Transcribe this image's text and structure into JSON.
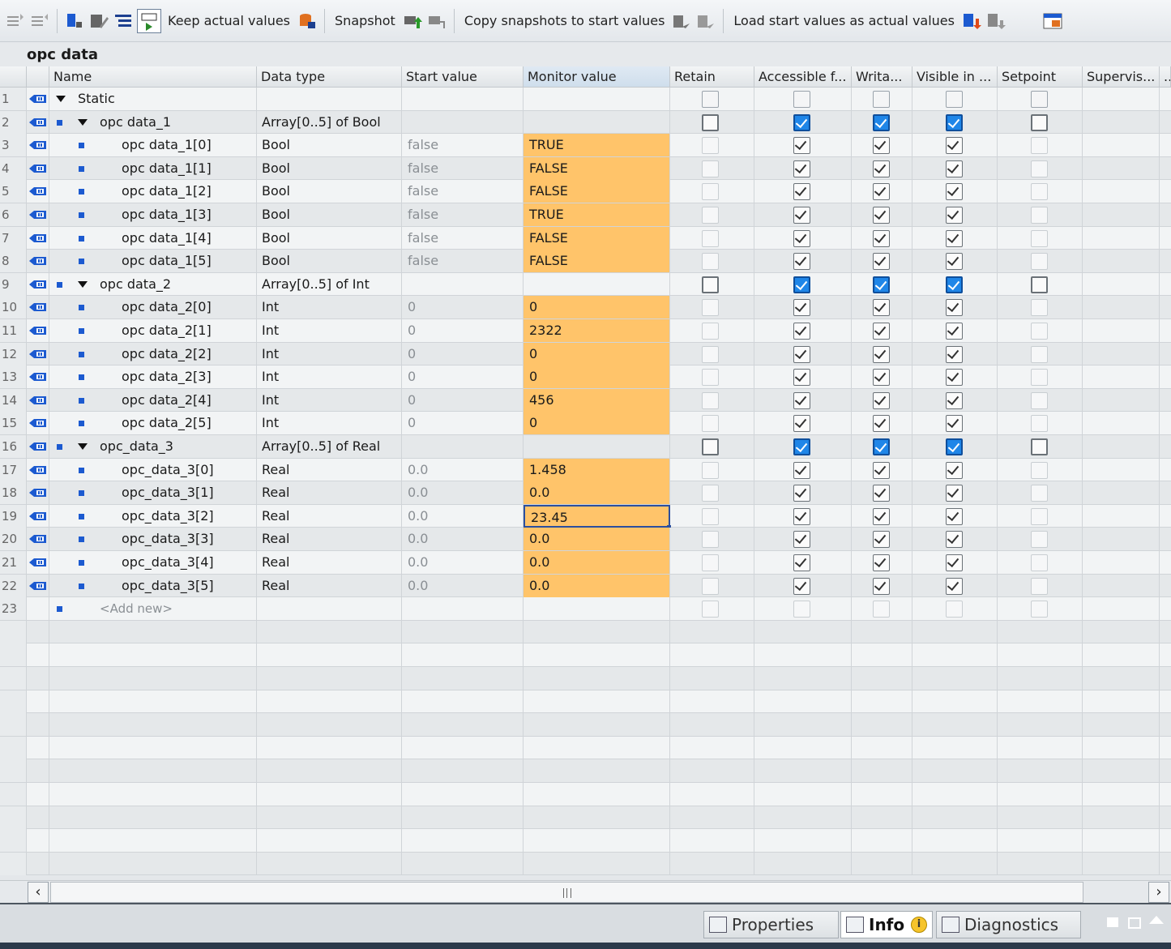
{
  "toolbar": {
    "keep_actual_label": "Keep actual values",
    "snapshot_label": "Snapshot",
    "copy_snapshots_label": "Copy snapshots to start values",
    "load_start_label": "Load start values as actual values"
  },
  "block_title": "opc data",
  "columns": {
    "name": "Name",
    "data_type": "Data type",
    "start_value": "Start value",
    "monitor_value": "Monitor value",
    "retain": "Retain",
    "accessible": "Accessible f...",
    "writable": "Writa...",
    "visible": "Visible in ...",
    "setpoint": "Setpoint",
    "supervision": "Supervis...",
    "more": ".."
  },
  "rows": [
    {
      "num": "1",
      "name": "Static",
      "type": "",
      "start": "",
      "monitor": "",
      "kind": "section"
    },
    {
      "num": "2",
      "name": "opc data_1",
      "type": "Array[0..5] of Bool",
      "start": "",
      "monitor": "",
      "kind": "array"
    },
    {
      "num": "3",
      "name": "opc data_1[0]",
      "type": "Bool",
      "start": "false",
      "monitor": "TRUE",
      "kind": "elem"
    },
    {
      "num": "4",
      "name": "opc data_1[1]",
      "type": "Bool",
      "start": "false",
      "monitor": "FALSE",
      "kind": "elem"
    },
    {
      "num": "5",
      "name": "opc data_1[2]",
      "type": "Bool",
      "start": "false",
      "monitor": "FALSE",
      "kind": "elem"
    },
    {
      "num": "6",
      "name": "opc data_1[3]",
      "type": "Bool",
      "start": "false",
      "monitor": "TRUE",
      "kind": "elem"
    },
    {
      "num": "7",
      "name": "opc data_1[4]",
      "type": "Bool",
      "start": "false",
      "monitor": "FALSE",
      "kind": "elem"
    },
    {
      "num": "8",
      "name": "opc data_1[5]",
      "type": "Bool",
      "start": "false",
      "monitor": "FALSE",
      "kind": "elem"
    },
    {
      "num": "9",
      "name": "opc data_2",
      "type": "Array[0..5] of Int",
      "start": "",
      "monitor": "",
      "kind": "array"
    },
    {
      "num": "10",
      "name": "opc data_2[0]",
      "type": "Int",
      "start": "0",
      "monitor": "0",
      "kind": "elem"
    },
    {
      "num": "11",
      "name": "opc data_2[1]",
      "type": "Int",
      "start": "0",
      "monitor": "2322",
      "kind": "elem"
    },
    {
      "num": "12",
      "name": "opc data_2[2]",
      "type": "Int",
      "start": "0",
      "monitor": "0",
      "kind": "elem"
    },
    {
      "num": "13",
      "name": "opc data_2[3]",
      "type": "Int",
      "start": "0",
      "monitor": "0",
      "kind": "elem"
    },
    {
      "num": "14",
      "name": "opc data_2[4]",
      "type": "Int",
      "start": "0",
      "monitor": "456",
      "kind": "elem"
    },
    {
      "num": "15",
      "name": "opc data_2[5]",
      "type": "Int",
      "start": "0",
      "monitor": "0",
      "kind": "elem"
    },
    {
      "num": "16",
      "name": "opc_data_3",
      "type": "Array[0..5] of Real",
      "start": "",
      "monitor": "",
      "kind": "array"
    },
    {
      "num": "17",
      "name": "opc_data_3[0]",
      "type": "Real",
      "start": "0.0",
      "monitor": "1.458",
      "kind": "elem"
    },
    {
      "num": "18",
      "name": "opc_data_3[1]",
      "type": "Real",
      "start": "0.0",
      "monitor": "0.0",
      "kind": "elem"
    },
    {
      "num": "19",
      "name": "opc_data_3[2]",
      "type": "Real",
      "start": "0.0",
      "monitor": "23.45",
      "kind": "elem",
      "selected": true
    },
    {
      "num": "20",
      "name": "opc_data_3[3]",
      "type": "Real",
      "start": "0.0",
      "monitor": "0.0",
      "kind": "elem"
    },
    {
      "num": "21",
      "name": "opc_data_3[4]",
      "type": "Real",
      "start": "0.0",
      "monitor": "0.0",
      "kind": "elem"
    },
    {
      "num": "22",
      "name": "opc_data_3[5]",
      "type": "Real",
      "start": "0.0",
      "monitor": "0.0",
      "kind": "elem"
    },
    {
      "num": "23",
      "name": "<Add new>",
      "type": "",
      "start": "",
      "monitor": "",
      "kind": "addnew"
    }
  ],
  "bottom_tabs": {
    "properties": "Properties",
    "info": "Info",
    "diagnostics": "Diagnostics",
    "info_badge": "i"
  },
  "colors": {
    "monitor_highlight": "#ffc46a",
    "check_blue": "#1f86e8",
    "accent_dark": "#2c3a4b"
  }
}
